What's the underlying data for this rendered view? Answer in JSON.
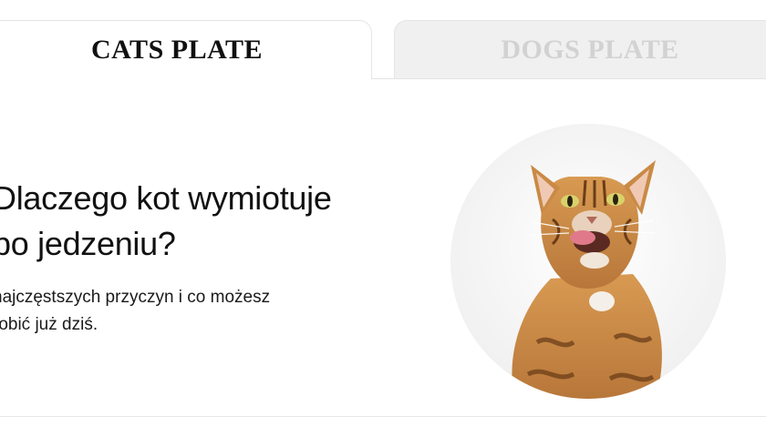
{
  "tabs": [
    {
      "label": "CATS PLATE",
      "active": true
    },
    {
      "label": "DOGS PLATE",
      "active": false
    }
  ],
  "article": {
    "title_line1": "Dlaczego kot wymiotuje",
    "title_line2": "po jedzeniu?",
    "subtitle_line1": "najczęstszych przyczyn i co możesz",
    "subtitle_line2": "robić już dziś."
  },
  "colors": {
    "text": "#111111",
    "inactive_tab_text": "#d2d2d2",
    "inactive_tab_bg": "#f0f0f0",
    "border": "#e4e4e4",
    "cat_fur": "#c98a45",
    "cat_tongue": "#e07a8a"
  }
}
